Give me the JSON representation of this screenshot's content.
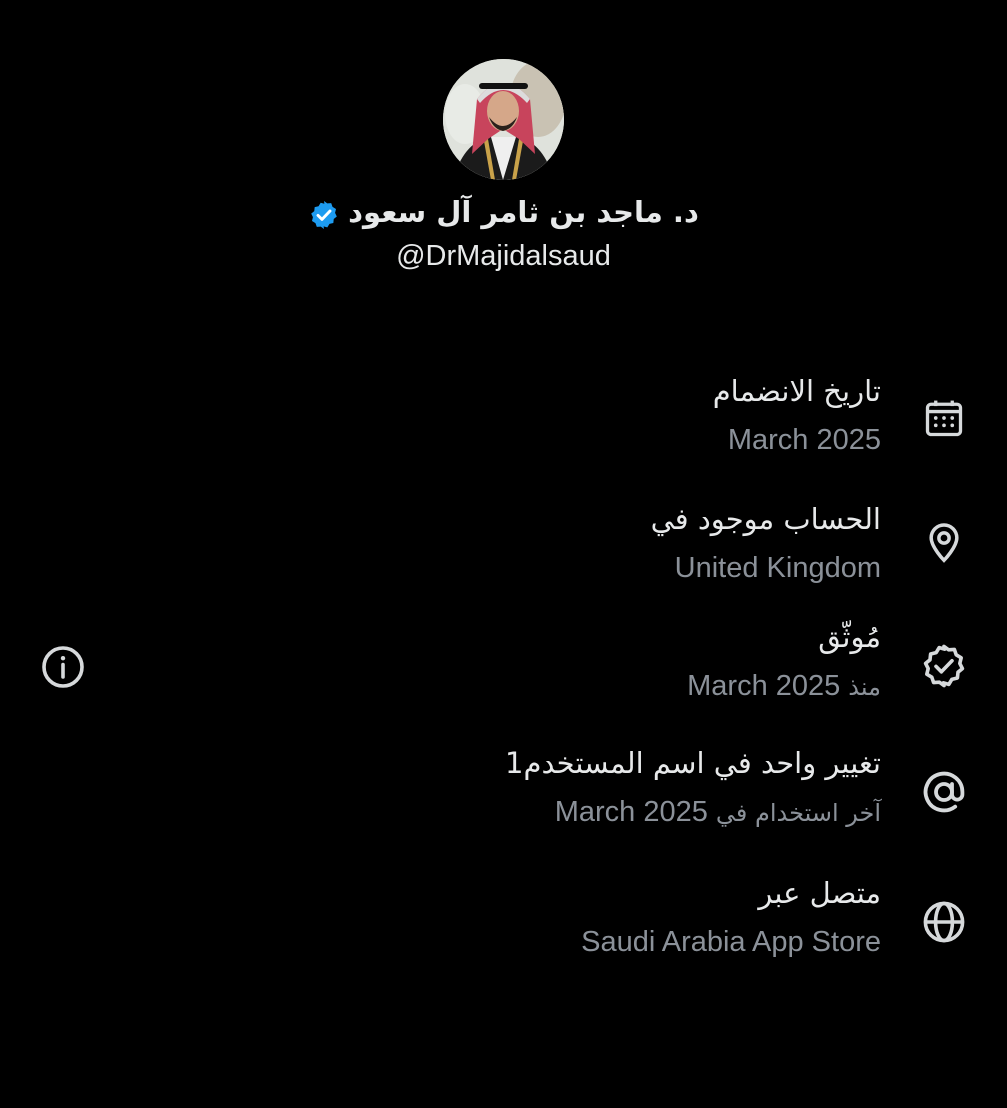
{
  "profile": {
    "display_name": "د. ماجد بن ثامر آل سعود",
    "handle": "@DrMajidalsaud",
    "verified": true,
    "badge_color": "#1d9bf0"
  },
  "about": [
    {
      "icon": "calendar-icon",
      "title": "تاريخ الانضمام",
      "value": "March 2025"
    },
    {
      "icon": "location-pin-icon",
      "title": "الحساب موجود في",
      "value": "United Kingdom"
    },
    {
      "icon": "verified-badge-icon",
      "title": "مُوثّق",
      "value_prefix": "منذ",
      "value": "March 2025"
    },
    {
      "icon": "at-sign-icon",
      "title": "تغيير واحد في اسم المستخدم1",
      "value_prefix": "آخر استخدام في",
      "value": "March 2025"
    },
    {
      "icon": "globe-icon",
      "title": "متصل عبر",
      "value": "Saudi Arabia App Store"
    }
  ],
  "side_icon": "info-icon",
  "colors": {
    "background": "#000000",
    "primary_text": "#e7e9ea",
    "secondary_text": "#8b9199",
    "icon": "#d6d9db"
  }
}
